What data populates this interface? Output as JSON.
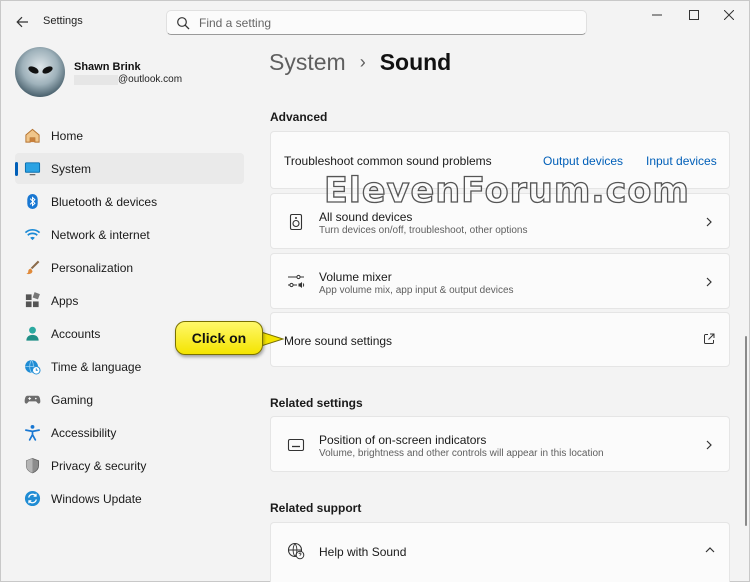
{
  "window": {
    "title": "Settings",
    "search_placeholder": "Find a setting"
  },
  "user": {
    "name": "Shawn Brink",
    "email_visible": "@outlook.com"
  },
  "nav": [
    {
      "label": "Home",
      "icon": "home-icon"
    },
    {
      "label": "System",
      "icon": "system-icon",
      "selected": true
    },
    {
      "label": "Bluetooth & devices",
      "icon": "bluetooth-icon"
    },
    {
      "label": "Network & internet",
      "icon": "wifi-icon"
    },
    {
      "label": "Personalization",
      "icon": "brush-icon"
    },
    {
      "label": "Apps",
      "icon": "apps-icon"
    },
    {
      "label": "Accounts",
      "icon": "person-icon"
    },
    {
      "label": "Time & language",
      "icon": "globe-clock-icon"
    },
    {
      "label": "Gaming",
      "icon": "gamepad-icon"
    },
    {
      "label": "Accessibility",
      "icon": "accessibility-icon"
    },
    {
      "label": "Privacy & security",
      "icon": "shield-icon"
    },
    {
      "label": "Windows Update",
      "icon": "update-icon"
    }
  ],
  "breadcrumb": {
    "parent": "System",
    "separator": "›",
    "current": "Sound"
  },
  "advanced": {
    "title": "Advanced",
    "troubleshoot": {
      "label": "Troubleshoot common sound problems",
      "link1": "Output devices",
      "link2": "Input devices"
    },
    "all_devices": {
      "title": "All sound devices",
      "subtitle": "Turn devices on/off, troubleshoot, other options"
    },
    "volume_mixer": {
      "title": "Volume mixer",
      "subtitle": "App volume mix, app input & output devices"
    },
    "more_sound": {
      "title": "More sound settings"
    }
  },
  "related_settings": {
    "title": "Related settings",
    "osd": {
      "title": "Position of on-screen indicators",
      "subtitle": "Volume, brightness and other controls will appear in this location"
    }
  },
  "related_support": {
    "title": "Related support",
    "help": {
      "title": "Help with Sound"
    }
  },
  "watermark": "ElevenForum.com",
  "callout": "Click on",
  "colors": {
    "accent": "#005fb8",
    "callout": "#f8ef2a",
    "background": "#f3f3f3",
    "card": "#fbfbfb"
  }
}
